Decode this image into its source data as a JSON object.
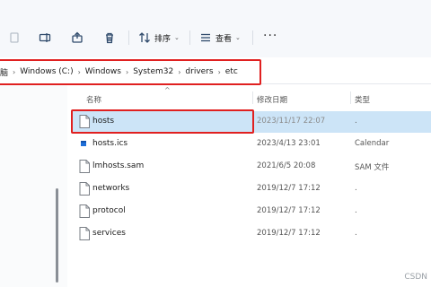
{
  "toolbar": {
    "sort_label": "排序",
    "view_label": "查看",
    "more_label": "···"
  },
  "address": {
    "crumbs": [
      "脑",
      "Windows (C:)",
      "Windows",
      "System32",
      "drivers",
      "etc"
    ]
  },
  "columns": {
    "name": "名称",
    "modified": "修改日期",
    "type": "类型"
  },
  "files": [
    {
      "name": "hosts",
      "modified": "2023/11/17 22:07",
      "type": ".",
      "selected": true,
      "icon": "document-icon"
    },
    {
      "name": "hosts.ics",
      "modified": "2023/4/13 23:01",
      "type": "Calendar",
      "selected": false,
      "icon": "calendar-file-icon"
    },
    {
      "name": "lmhosts.sam",
      "modified": "2021/6/5 20:08",
      "type": "SAM 文件",
      "selected": false,
      "icon": "document-icon"
    },
    {
      "name": "networks",
      "modified": "2019/12/7 17:12",
      "type": ".",
      "selected": false,
      "icon": "document-icon"
    },
    {
      "name": "protocol",
      "modified": "2019/12/7 17:12",
      "type": ".",
      "selected": false,
      "icon": "document-icon"
    },
    {
      "name": "services",
      "modified": "2019/12/7 17:12",
      "type": ".",
      "selected": false,
      "icon": "document-icon"
    }
  ],
  "watermark": "CSDN",
  "colors": {
    "selection": "#cce4f7",
    "highlight_border": "#e02020",
    "calendar_icon": "#1e6fd9"
  }
}
